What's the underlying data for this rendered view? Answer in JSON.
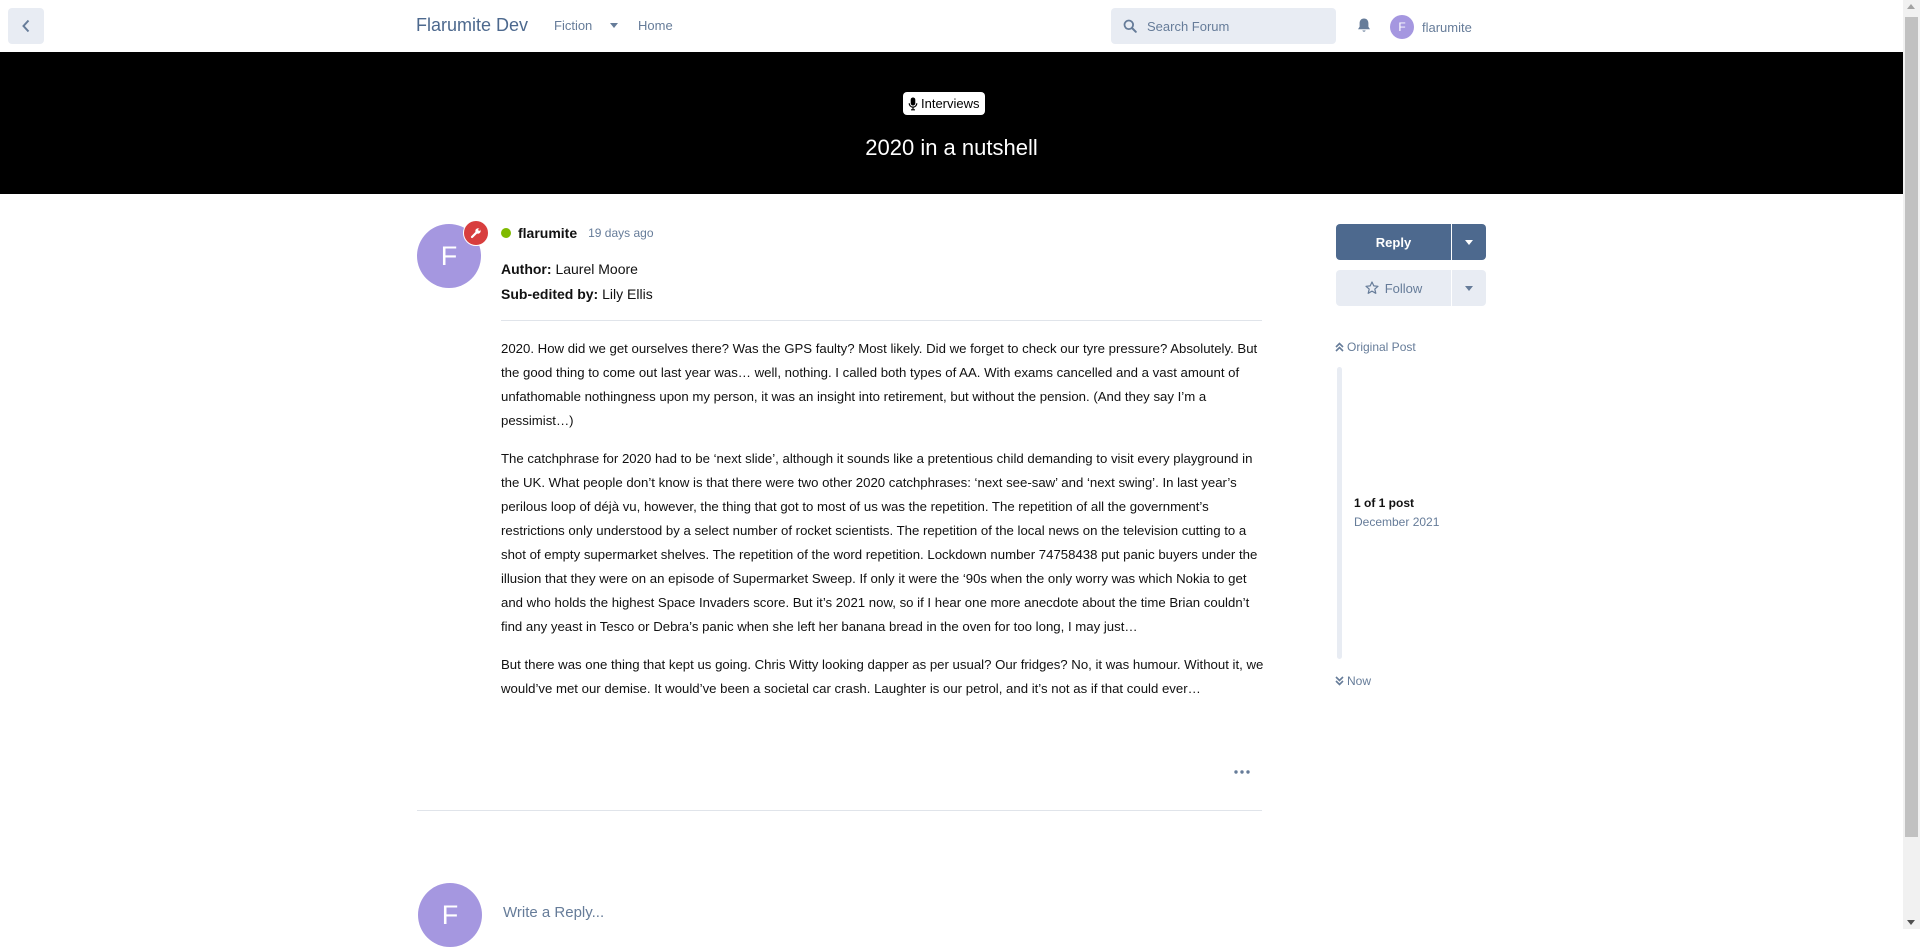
{
  "header": {
    "site_title": "Flarumite Dev",
    "nav_dropdown_label": "Fiction",
    "nav_home": "Home",
    "search_placeholder": "Search Forum",
    "user_initial": "F",
    "username": "flarumite"
  },
  "discussion": {
    "tag_label": "Interviews",
    "title": "2020 in a nutshell"
  },
  "post": {
    "avatar_initial": "F",
    "username": "flarumite",
    "time_ago": "19 days ago",
    "author_label": "Author:",
    "author_name": "Laurel Moore",
    "subeditor_label": "Sub-edited by:",
    "subeditor_name": "Lily Ellis",
    "paragraphs": [
      "2020. How did we get ourselves there? Was the GPS faulty? Most likely. Did we forget to check our tyre pressure? Absolutely. But the good thing to come out last year was… well, nothing. I called both types of AA. With exams cancelled and a vast amount of unfathomable nothingness upon my person, it was an insight into retirement, but without the pension. (And they say I’m a pessimist…)",
      "The catchphrase for 2020 had to be ‘next slide’, although it sounds like a pretentious child demanding to visit every playground in the UK. What people don’t know is that there were two other 2020 catchphrases: ‘next see-saw’ and ‘next swing’. In last year’s perilous loop of déjà vu, however, the thing that got to most of us was the repetition. The repetition of all the government’s restrictions only understood by a select number of rocket scientists. The repetition of the local news on the television cutting to a shot of empty supermarket shelves. The repetition of the word repetition. Lockdown number 74758438 put panic buyers under the illusion that they were on an episode of Supermarket Sweep. If only it were the ‘90s when the only worry was which Nokia to get and who holds the highest Space Invaders score. But it’s 2021 now, so if I hear one more anecdote about the time Brian couldn’t find any yeast in Tesco or Debra’s panic when she left her banana bread in the oven for too long, I may just…",
      "But there was one thing that kept us going. Chris Witty looking dapper as per usual? Our fridges? No, it was humour. Without it, we would’ve met our demise. It would’ve been a societal car crash. Laughter is our petrol, and it’s not as if that could ever…"
    ]
  },
  "reply_composer": {
    "avatar_initial": "F",
    "placeholder": "Write a Reply..."
  },
  "sidebar": {
    "reply_label": "Reply",
    "follow_label": "Follow",
    "scrubber": {
      "original_post": "Original Post",
      "count": "1 of 1 post",
      "date": "December 2021",
      "now": "Now"
    }
  },
  "colors": {
    "primary": "#4d698e",
    "muted": "#667c99",
    "control_bg": "#e8ecf3",
    "avatar": "#a597e0",
    "badge_red": "#d83e3e",
    "online_green": "#7fba00",
    "hero_bg": "#000000"
  }
}
